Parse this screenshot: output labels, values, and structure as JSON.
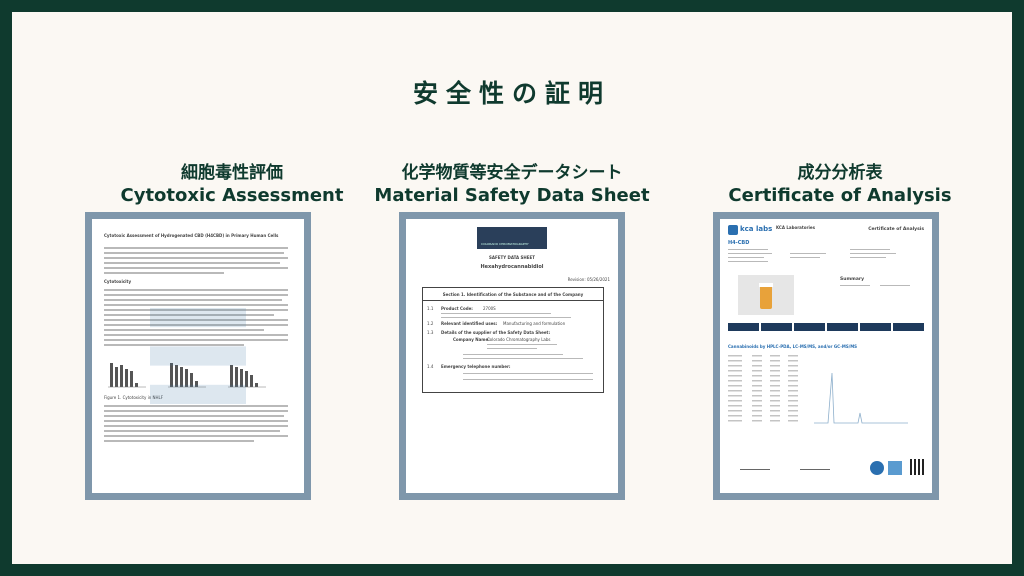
{
  "page": {
    "title": "安全性の証明"
  },
  "sections": [
    {
      "jp": "細胞毒性評価",
      "en": "Cytotoxic Assessment",
      "doc": {
        "heading": "Cytotoxic Assessment of Hydrogenated CBD (H4CBD) in Primary Human Cells",
        "sub1": "Cytotoxicity",
        "figure_caption": "Figure 1. Cytotoxicity in NHLF"
      }
    },
    {
      "jp": "化学物質等安全データシート",
      "en": "Material Safety Data Sheet",
      "doc": {
        "logo_text": "COLORADO CHROMATOGRAPHY",
        "sheet_label": "SAFETY DATA SHEET",
        "product": "Hexahydrocannabidiol",
        "revision": "Revision: 05/26/2021",
        "section_title": "Section 1. Identification of the Substance and of the Company",
        "rows": [
          {
            "num": "1.1",
            "label": "Product Code:",
            "value": "2700S"
          },
          {
            "num": "1.2",
            "label": "Relevant identified uses:",
            "value": "Manufacturing and formulation"
          },
          {
            "num": "1.3",
            "label": "Details of the supplier of the Safety Data Sheet:",
            "value": ""
          },
          {
            "num": "",
            "label": "Company Name:",
            "value": "Colorado Chromatography Labs"
          },
          {
            "num": "1.4",
            "label": "Emergency telephone number:",
            "value": ""
          }
        ]
      }
    },
    {
      "jp": "成分分析表",
      "en": "Certificate of Analysis",
      "doc": {
        "lab_logo": "kca labs",
        "lab_name": "KCA Laboratories",
        "coa_title": "Certificate of Analysis",
        "sample": "H4-CBD",
        "summary_label": "Summary",
        "cannabinoids_label": "Cannabinoids by HPLC-PDA, LC-MS/MS, and/or GC-MS/MS"
      }
    }
  ],
  "colors": {
    "background_outer": "#0f3a2e",
    "background_inner": "#fbf8f3",
    "text": "#0f3a2e",
    "doc_border": "#7f97ab"
  }
}
